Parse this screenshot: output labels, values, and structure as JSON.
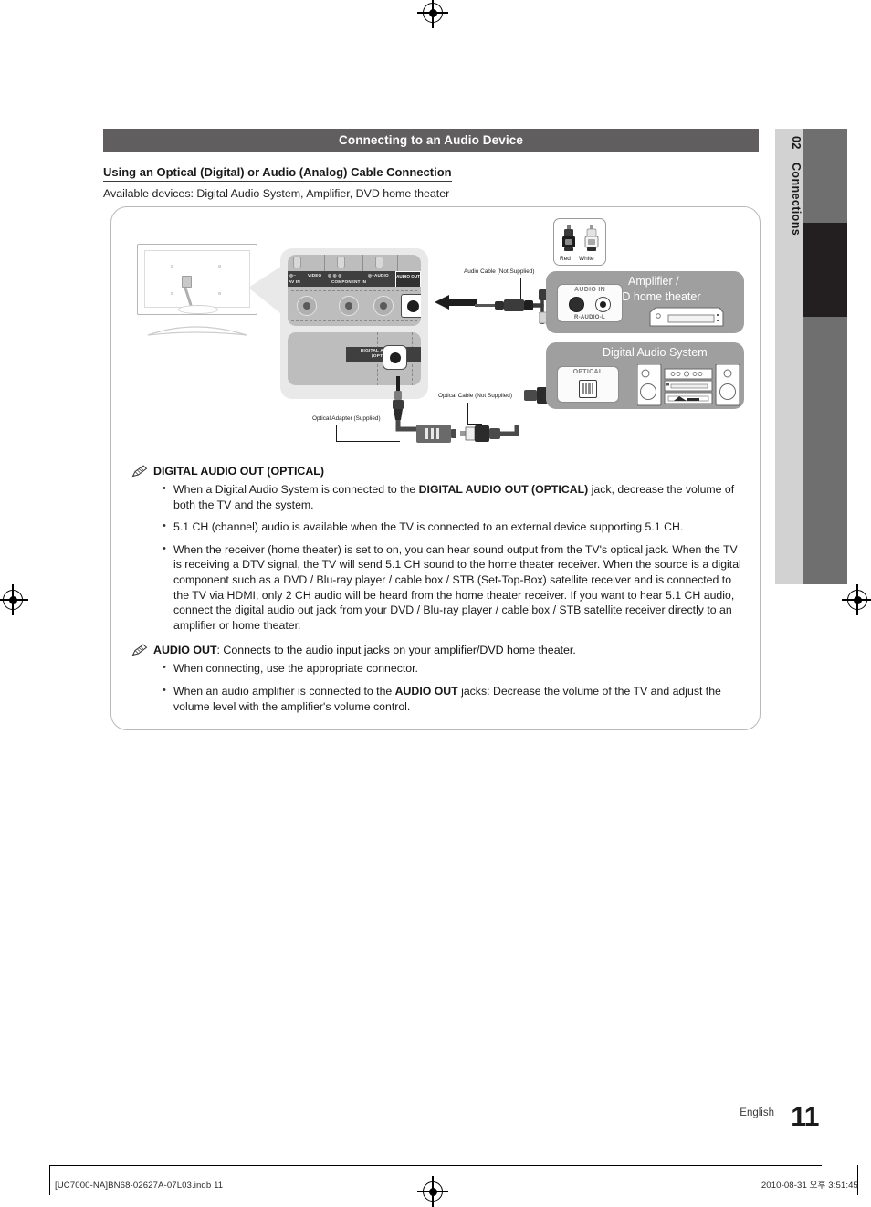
{
  "section": {
    "header_title": "Connecting to an Audio Device",
    "subheading": "Using an Optical (Digital) or Audio (Analog) Cable Connection",
    "available_devices": "Available devices: Digital Audio System, Amplifier, DVD home theater"
  },
  "diagram": {
    "panel_labels": {
      "av_in": "AV IN",
      "video": "VIDEO",
      "component_in": "COMPONENT IN",
      "audio": "AUDIO",
      "audio_out": "AUDIO OUT",
      "digital_audio_out_optical": "DIGITAL AUDIO OUT (OPTICAL)"
    },
    "callouts": {
      "audio_cable": "Audio Cable (Not Supplied)",
      "optical_cable": "Optical Cable (Not Supplied)",
      "optical_adapter": "Optical Adapter (Supplied)"
    },
    "legend": {
      "red": "Red",
      "white": "White"
    },
    "devices": [
      {
        "title": "Amplifier /",
        "title_line2": "DVD home theater",
        "jack_caption": "AUDIO IN",
        "jack_sub": "R-AUDIO-L"
      },
      {
        "title": "Digital Audio System",
        "jack_caption": "OPTICAL"
      }
    ]
  },
  "notes": [
    {
      "icon": "note-pen-icon",
      "heading_plain": "",
      "heading_bold": "DIGITAL AUDIO OUT (OPTICAL)",
      "heading_tail": "",
      "bullets": [
        "When a Digital Audio System is connected to the DIGITAL AUDIO OUT (OPTICAL) jack, decrease the volume of both the TV and the system.",
        "5.1 CH (channel) audio is available when the TV is connected to an external device supporting 5.1 CH.",
        "When the receiver (home theater) is set to on, you can hear sound output from the TV's optical jack. When the TV is receiving a DTV signal, the TV will send 5.1 CH sound to the home theater receiver. When the source is a digital component such as a DVD / Blu-ray player / cable box / STB (Set-Top-Box) satellite receiver and is connected to the TV via HDMI, only 2 CH audio will be heard from the home theater receiver. If you want to hear 5.1 CH audio, connect the digital audio out jack from your DVD / Blu-ray player / cable box / STB satellite receiver directly to an amplifier or home theater."
      ]
    },
    {
      "icon": "note-pen-icon",
      "heading_bold": "AUDIO OUT",
      "heading_tail": ": Connects to the audio input jacks on your amplifier/DVD home theater.",
      "bullets": [
        "When connecting, use the appropriate connector.",
        "When an audio amplifier is connected to the AUDIO OUT jacks: Decrease the volume of the TV and adjust the volume level with the amplifier's volume control."
      ]
    }
  ],
  "sidebar": {
    "chapter_number": "02",
    "chapter_title": "Connections"
  },
  "footer": {
    "language": "English",
    "page_number": "11",
    "file_ref": "[UC7000-NA]BN68-02627A-07L03.indb   11",
    "timestamp": "2010-08-31   오후 3:51:45"
  },
  "colors": {
    "header_bar": "#605e5e",
    "tab_grey": "#d2d2d2",
    "tab_strip": "#706f6f",
    "tab_strip_dark": "#231f20",
    "device_panel": "#9f9f9f"
  }
}
